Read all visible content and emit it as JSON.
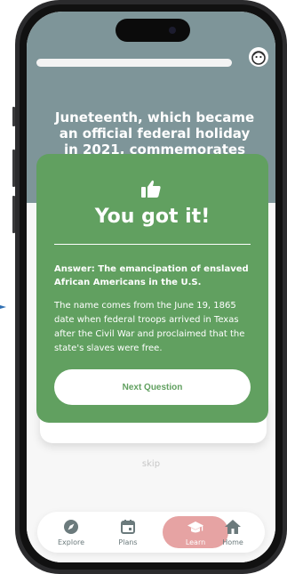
{
  "question": {
    "text": "Juneteenth, which became an official federal holiday in 2021, commemorates this:"
  },
  "result": {
    "headline": "You got it!",
    "answer": "Answer: The emancipation of enslaved African Americans in the U.S.",
    "explanation": "The name comes from the June 19, 1865 date when federal troops arrived in Texas after the Civil War and proclaimed that the state's slaves were free.",
    "next_label": "Next Question"
  },
  "skip_label": "skip",
  "nav": {
    "items": [
      {
        "label": "Explore",
        "icon": "compass-icon"
      },
      {
        "label": "Plans",
        "icon": "calendar-icon"
      },
      {
        "label": "Learn",
        "icon": "graduation-cap-icon",
        "active": true
      },
      {
        "label": "Home",
        "icon": "home-icon"
      }
    ]
  },
  "colors": {
    "card_green": "#61a060",
    "header_gray": "#7e9599",
    "learn_pink": "#e6a3a3"
  }
}
